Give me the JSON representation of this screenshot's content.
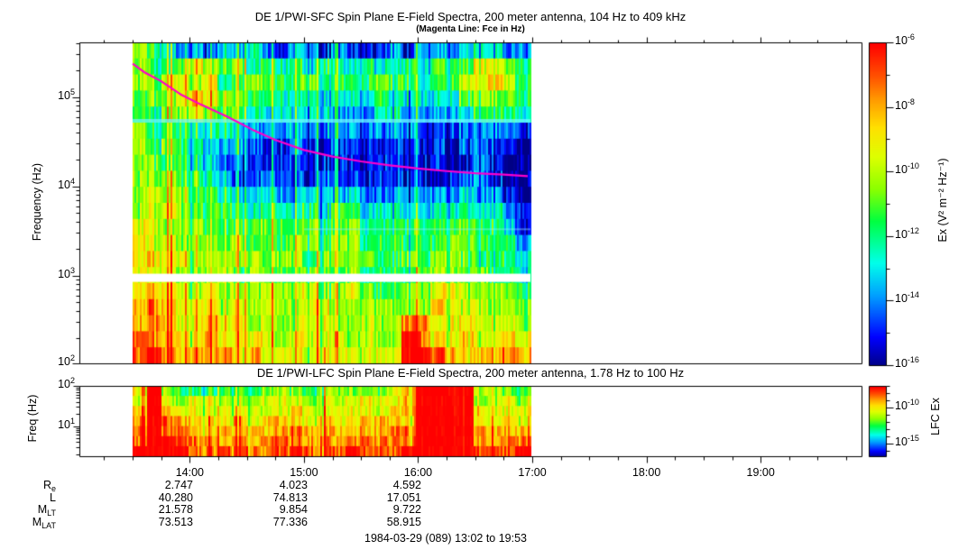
{
  "footer": "1984-03-29 (089) 13:02 to 19:53",
  "colormap": [
    [
      0.0,
      "#000085"
    ],
    [
      0.09,
      "#0000ff"
    ],
    [
      0.22,
      "#00a0ff"
    ],
    [
      0.32,
      "#00ffea"
    ],
    [
      0.45,
      "#00ff40"
    ],
    [
      0.55,
      "#8cff00"
    ],
    [
      0.65,
      "#deff00"
    ],
    [
      0.74,
      "#ffe000"
    ],
    [
      0.82,
      "#ffa000"
    ],
    [
      0.9,
      "#ff5000"
    ],
    [
      1.0,
      "#ff0000"
    ]
  ],
  "ephemeris": {
    "rows": [
      {
        "label": "R",
        "sub": "e",
        "values": [
          "2.747",
          "4.023",
          "4.592"
        ]
      },
      {
        "label": "L",
        "sub": "",
        "values": [
          "40.280",
          "74.813",
          "17.051"
        ]
      },
      {
        "label": "M",
        "sub": "LT",
        "values": [
          "21.578",
          "9.854",
          "9.722"
        ]
      },
      {
        "label": "M",
        "sub": "LAT",
        "values": [
          "73.513",
          "77.336",
          "58.915"
        ]
      }
    ]
  },
  "chart_data": [
    {
      "id": "sfc",
      "type": "heatmap",
      "title": "DE 1/PWI-SFC  Spin Plane E-Field Spectra, 200 meter antenna, 104 Hz to 409 kHz",
      "subtitle": "(Magenta Line: Fce in Hz)",
      "ylabel": "Frequency (Hz)",
      "x_range": [
        13.0333,
        19.8833
      ],
      "data_x_range": [
        13.5,
        16.98
      ],
      "y_range_hz": [
        104,
        409000
      ],
      "y_log": true,
      "x_major_ticks_hours": [
        14,
        15,
        16,
        17,
        18,
        19
      ],
      "x_tick_labels": [
        "14:00",
        "15:00",
        "16:00",
        "17:00",
        "18:00",
        "19:00"
      ],
      "x_minor_step_hours": 0.25,
      "y_tick_exponents": [
        5,
        4,
        3,
        2
      ],
      "value_exp_range": [
        -16,
        -6
      ],
      "grid_note": "digits 0-9 map log10 power -16 (dark blue) to -6 (red); rows top=409kHz to bottom=104Hz, cols 13:30-17:00",
      "grid_levels": [
        "5432212232122121112122233322",
        "5445654534343433433434456654",
        "5566563455445444454434466764",
        "4556765444334333343333355554",
        "4455654433333322233222234443",
        "5444333222222222222211122221",
        "5454322211121111111111022110",
        "5544321111111111111111012100",
        "5554432112111211111110122100",
        "5655443223223323222222232210",
        "5665444334334344333333343321",
        "6655544445445445444444454431",
        "6665554545455455444444554442",
        "6766555555554555544545554443",
        "6665555455445545444455555443",
        "6776565556556556544556665554",
        "7876665656556655655557666555",
        "7876676656556655655886676665",
        "8877676666566665655986676676",
        "8987777676666766666998777787"
      ],
      "white_gap_hz": [
        850,
        1050
      ],
      "cyan_band_hz": [
        51600,
        56700
      ],
      "faint_band": {
        "hz": 3300,
        "x_hours": [
          15.0,
          16.98
        ]
      },
      "fce_color": "#ff00cc",
      "fce_line": [
        [
          13.5,
          236000
        ],
        [
          13.6,
          190000
        ],
        [
          13.75,
          150000
        ],
        [
          13.92,
          107000
        ],
        [
          14.1,
          82000
        ],
        [
          14.33,
          60000
        ],
        [
          14.55,
          43000
        ],
        [
          14.75,
          33000
        ],
        [
          15.0,
          25500
        ],
        [
          15.25,
          21500
        ],
        [
          15.5,
          19000
        ],
        [
          15.75,
          17200
        ],
        [
          16.0,
          15800
        ],
        [
          16.25,
          14800
        ],
        [
          16.5,
          14000
        ],
        [
          16.75,
          13500
        ],
        [
          16.96,
          13000
        ]
      ],
      "colorbar": {
        "label": "Ex (V² m⁻² Hz⁻¹)",
        "exp_range": [
          -6,
          -16
        ],
        "tick_exponents": [
          -6,
          -7,
          -8,
          -9,
          -10,
          -11,
          -12,
          -13,
          -14,
          -15,
          -16
        ],
        "labeled_exponents": [
          -6,
          -8,
          -10,
          -12,
          -14,
          -16
        ]
      }
    },
    {
      "id": "lfc",
      "type": "heatmap",
      "title": "DE 1/PWI-LFC  Spin Plane E-Field Spectra, 200 meter antenna, 1.78 Hz to 100 Hz",
      "ylabel": "Freq (Hz)",
      "x_range": [
        13.0333,
        19.8833
      ],
      "data_x_range": [
        13.5,
        16.98
      ],
      "y_range_hz": [
        1.78,
        100
      ],
      "y_log": true,
      "y_tick_exponents": [
        2,
        1
      ],
      "grid_note": "rows top=100Hz to bottom=1.78Hz",
      "grid_levels": [
        "6954444445554555556799995554",
        "6965665556665656666799995565",
        "7976666666676666667799996666",
        "7987776767776767777799996676",
        "8988777777787777778899997777",
        "8998887878887878888899997788",
        "9999888888898889888999998889"
      ],
      "colorbar": {
        "label": "LFC Ex",
        "exp_range": [
          -7,
          -16.75
        ],
        "tick_exponents": [
          -7,
          -8,
          -9,
          -10,
          -11,
          -12,
          -13,
          -14,
          -15,
          -16
        ],
        "labeled_exponents": [
          -10,
          -15
        ]
      }
    }
  ]
}
